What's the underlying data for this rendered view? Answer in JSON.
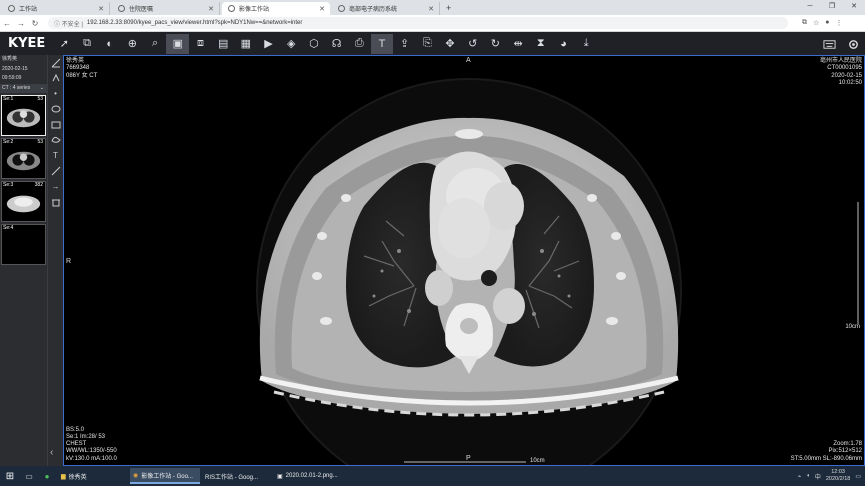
{
  "browser": {
    "tabs": [
      {
        "label": "工作站",
        "active": false
      },
      {
        "label": "住院医嘱",
        "active": false
      },
      {
        "label": "影像工作站",
        "active": true
      },
      {
        "label": "亳部电子病历系统",
        "active": false
      }
    ],
    "new_tab": "+",
    "security_label": "不安全",
    "url": "192.168.2.33:8090/kyee_pacs_view/viewer.html?spk=NDY1Nw==&network=inter"
  },
  "app": {
    "logo": "KYEE",
    "toolbar_icons": [
      "select-icon",
      "series-icon",
      "window-level-icon",
      "zoom-icon",
      "magnify-icon",
      "window-preset-icon",
      "stack-icon",
      "layout-icon",
      "grid-icon",
      "play-icon",
      "3d-icon",
      "mpr-icon",
      "vr-icon",
      "print-icon",
      "text-icon",
      "export-icon",
      "report-icon",
      "pan-icon",
      "rotate-left-icon",
      "rotate-right-icon",
      "flip-icon",
      "invert-icon",
      "color-icon",
      "download-icon"
    ],
    "right_icons": [
      "keyboard-icon",
      "settings-icon"
    ]
  },
  "series_panel": {
    "patient_name": "徐秀英",
    "study_date": "2020-02-15",
    "study_time": "09:59:09",
    "summary": "CT : 4 series",
    "series": [
      {
        "label": "Se:1",
        "count": "53"
      },
      {
        "label": "Se:2",
        "count": "53"
      },
      {
        "label": "Se:3",
        "count": "382"
      },
      {
        "label": "Se:4",
        "count": ""
      }
    ]
  },
  "overlay": {
    "top_left": [
      "徐秀英",
      "7669348",
      "086Y 女 CT"
    ],
    "top_right": [
      "亳州市人民医院",
      "CT00001095",
      "2020-02-15",
      "10:02:50"
    ],
    "bottom_left": [
      "BS:5.0",
      "Se:1 Im:28/ 53",
      "CHEST",
      "WW/WL:1350/-550",
      "kV:130.0 mA:100.0"
    ],
    "bottom_right": [
      "Zoom:1.78",
      "Pix:512×512",
      "ST:5.00mm SL:-890.06mm"
    ],
    "orient_top": "A",
    "orient_left": "R",
    "orient_bottom": "P",
    "scale_right": "10cm",
    "scale_bottom": "10cm"
  },
  "taskbar": {
    "apps": [
      {
        "label": "徐秀英",
        "active": false
      },
      {
        "label": "影像工作站 - Goo...",
        "active": true
      },
      {
        "label": "RIS工作站 - Goog...",
        "active": false
      },
      {
        "label": "2020.02.01-2.png...",
        "active": false
      }
    ],
    "time": "12:03",
    "date": "2020/2/18",
    "ime": "中"
  }
}
